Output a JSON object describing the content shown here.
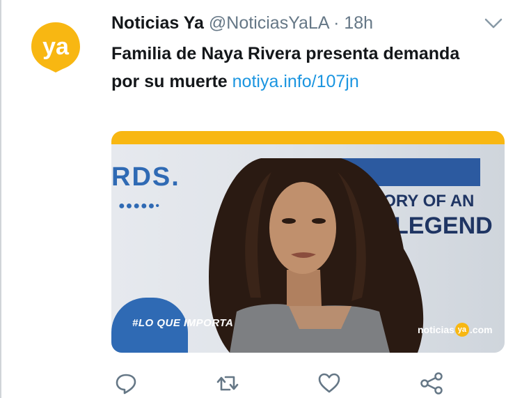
{
  "tweet": {
    "display_name": "Noticias Ya",
    "handle": "@NoticiasYaLA",
    "separator": "·",
    "time": "18h",
    "text": "Familia de Naya Rivera presenta demanda por su muerte",
    "link": "notiya.info/107jn"
  },
  "avatar": {
    "label": "ya",
    "color": "#f8b712",
    "icon": "map-pin-logo-icon"
  },
  "media": {
    "overlay_hashtag": "#LO QUE IMPORTA",
    "brand_prefix": "noticias",
    "brand_ya": "ya",
    "brand_suffix": ".com",
    "press_text_1": "RDS.",
    "press_text_2": "STORY OF AN",
    "press_text_3": "N LEGEND",
    "accent_color": "#f8b712"
  },
  "actions": {
    "reply_icon": "reply-icon",
    "retweet_icon": "retweet-icon",
    "like_icon": "heart-icon",
    "share_icon": "share-icon"
  },
  "colors": {
    "text_primary": "#14171a",
    "text_secondary": "#657786",
    "link": "#1b95e0"
  }
}
